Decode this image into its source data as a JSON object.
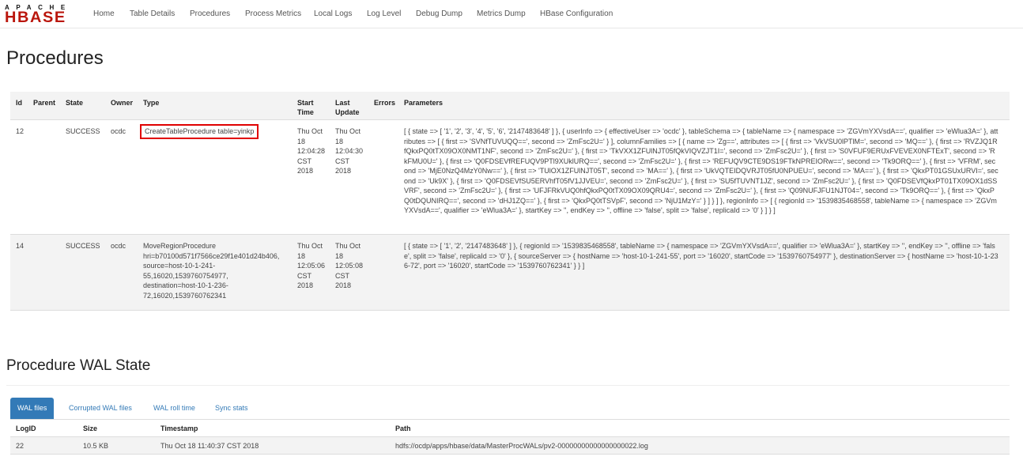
{
  "logo": {
    "apache": "APACHE",
    "hbase": "HBASE"
  },
  "nav": [
    "Home",
    "Table Details",
    "Procedures",
    "Process Metrics",
    "Local Logs",
    "Log Level",
    "Debug Dump",
    "Metrics Dump",
    "HBase Configuration"
  ],
  "page_title": "Procedures",
  "procedures": {
    "headers": {
      "id": "Id",
      "parent": "Parent",
      "state": "State",
      "owner": "Owner",
      "type": "Type",
      "start_1": "Start",
      "start_2": "Time",
      "update_1": "Last",
      "update_2": "Update",
      "errors": "Errors",
      "parameters": "Parameters"
    },
    "rows": [
      {
        "id": "12",
        "parent": "",
        "state": "SUCCESS",
        "owner": "ocdc",
        "type": "CreateTableProcedure table=yinkp",
        "start": [
          "Thu Oct",
          "18",
          "12:04:28",
          "CST",
          "2018"
        ],
        "update": [
          "Thu Oct",
          "18",
          "12:04:30",
          "CST",
          "2018"
        ],
        "errors": "",
        "parameters": "[ { state => [ '1', '2', '3', '4', '5', '6', '2147483648' ] }, { userInfo => { effectiveUser => 'ocdc' }, tableSchema => { tableName => { namespace => 'ZGVmYXVsdA==', qualifier => 'eWlua3A=' }, attributes => [ { first => 'SVNfTUVUQQ==', second => 'ZmFsc2U=' } ], columnFamilies => [ { name => 'Zg==', attributes => [ { first => 'VkVSU0lPTlM=', second => 'MQ==' }, { first => 'RVZJQ1RfQkxPQ0tTX09OX0NMT1NF', second => 'ZmFsc2U=' }, { first => 'TkVXX1ZFUlNJT05fQkVIQVZJT1I=', second => 'ZmFsc2U=' }, { first => 'S0VFUF9ERUxFVEVEX0NFTExT', second => 'RkFMU0U=' }, { first => 'Q0FDSEVfREFUQV9PTl9XUklURQ==', second => 'ZmFsc2U=' }, { first => 'REFUQV9CTE9DS19FTkNPREIORw==', second => 'Tk9ORQ==' }, { first => 'VFRM', second => 'MjE0NzQ4MzY0Nw==' }, { first => 'TUlOX1ZFUlNJT05T', second => 'MA==' }, { first => 'UkVQTEIDQVRJT05fU0NPUEU=', second => 'MA==' }, { first => 'QkxPT01GSUxURVI=', second => 'Uk9X' }, { first => 'Q0FDSEVfSU5ERVhfT05fV1JJVEU=', second => 'ZmFsc2U=' }, { first => 'SU5fTUVNT1JZ', second => 'ZmFsc2U=' }, { first => 'Q0FDSEVfQkxPT01TX09OX1dSSVRF', second => 'ZmFsc2U=' }, { first => 'UFJFRkVUQ0hfQkxPQ0tTX09OX09QRU4=', second => 'ZmFsc2U=' }, { first => 'Q09NUFJFU1NJT04=', second => 'Tk9ORQ==' }, { first => 'QkxPQ0tDQUNIRQ==', second => 'dHJ1ZQ==' }, { first => 'QkxPQ0tTSVpF', second => 'NjU1MzY=' } ] } ] }, regionInfo => [ { regionId => '1539835468558', tableName => { namespace => 'ZGVmYXVsdA==', qualifier => 'eWlua3A=' }, startKey => '', endKey => '', offline => 'false', split => 'false', replicaId => '0' } ] } ]"
      },
      {
        "id": "14",
        "parent": "",
        "state": "SUCCESS",
        "owner": "ocdc",
        "type": [
          "MoveRegionProcedure",
          "hri=b70100d571f7566ce29f1e401d24b406,",
          "source=host-10-1-241-",
          "55,16020,1539760754977,",
          "destination=host-10-1-236-",
          "72,16020,1539760762341"
        ],
        "start": [
          "Thu Oct",
          "18",
          "12:05:06",
          "CST",
          "2018"
        ],
        "update": [
          "Thu Oct",
          "18",
          "12:05:08",
          "CST",
          "2018"
        ],
        "errors": "",
        "parameters": "[ { state => [ '1', '2', '2147483648' ] }, { regionId => '1539835468558', tableName => { namespace => 'ZGVmYXVsdA==', qualifier => 'eWlua3A=' }, startKey => '', endKey => '', offline => 'false', split => 'false', replicaId => '0' }, { sourceServer => { hostName => 'host-10-1-241-55', port => '16020', startCode => '1539760754977' }, destinationServer => { hostName => 'host-10-1-236-72', port => '16020', startCode => '1539760762341' } } ]"
      }
    ]
  },
  "wal": {
    "title": "Procedure WAL State",
    "tabs": [
      "WAL files",
      "Corrupted WAL files",
      "WAL roll time",
      "Sync stats"
    ],
    "active_tab": "WAL files",
    "headers": {
      "logid": "LogID",
      "size": "Size",
      "timestamp": "Timestamp",
      "path": "Path"
    },
    "rows": [
      {
        "logid": "22",
        "size": "10.5 KB",
        "timestamp": "Thu Oct 18 11:40:37 CST 2018",
        "path": "hdfs://ocdp/apps/hbase/data/MasterProcWALs/pv2-00000000000000000022.log"
      }
    ]
  }
}
